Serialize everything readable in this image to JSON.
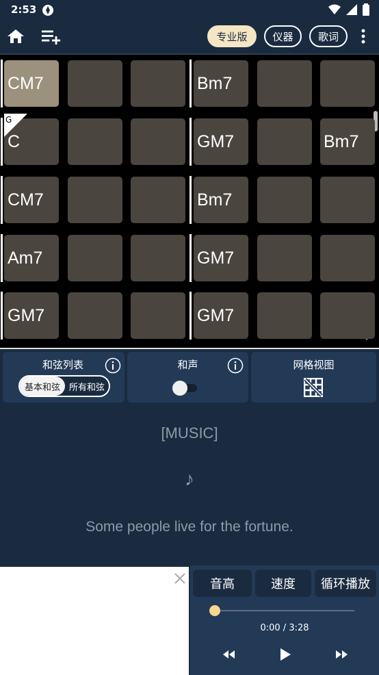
{
  "status": {
    "time": "2:53"
  },
  "toolbar": {
    "pro_label": "专业版",
    "instrument_label": "仪器",
    "lyrics_label": "歌词"
  },
  "grid": {
    "key": "G",
    "rows": [
      [
        "CM7",
        "",
        "",
        "Bm7",
        "",
        ""
      ],
      [
        "C",
        "",
        "",
        "GM7",
        "",
        "Bm7"
      ],
      [
        "CM7",
        "",
        "",
        "Bm7",
        "",
        ""
      ],
      [
        "Am7",
        "",
        "",
        "GM7",
        "",
        ""
      ],
      [
        "GM7",
        "",
        "",
        "GM7",
        "",
        ""
      ]
    ],
    "selected": [
      0,
      0
    ]
  },
  "controls": {
    "chord_list_label": "和弦列表",
    "basic_chords": "基本和弦",
    "all_chords": "所有和弦",
    "harmony_label": "和声",
    "grid_view_label": "网格视图"
  },
  "lyrics": {
    "section": "[MUSIC]",
    "note": "♪",
    "line": "Some people live for the fortune."
  },
  "player": {
    "pitch_label": "音高",
    "speed_label": "速度",
    "loop_label": "循环播放",
    "time": "0:00 / 3:28",
    "progress": 0
  },
  "colors": {
    "background": "#1a2b40",
    "panel": "#233a57",
    "cell": "#4a453f",
    "selected_cell": "#9b917c",
    "accent": "#f5e6c4",
    "thumb": "#f5d78e"
  }
}
